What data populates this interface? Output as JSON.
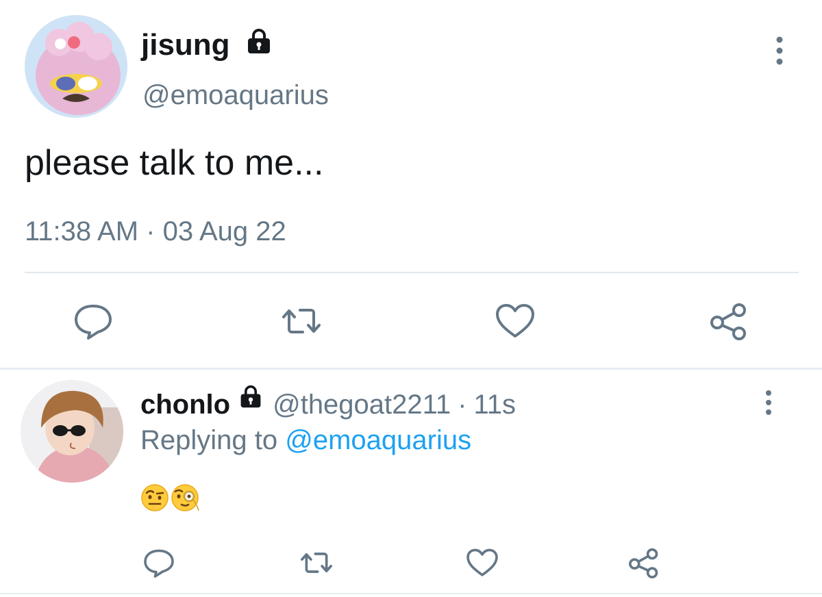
{
  "tweet": {
    "display_name": "jisung",
    "handle": "@emoaquarius",
    "text": "please talk to me...",
    "timestamp": "11:38 AM · 03 Aug 22",
    "protected_icon": "lock-icon",
    "actions": [
      "reply-icon",
      "retweet-icon",
      "like-icon",
      "share-icon"
    ]
  },
  "reply": {
    "display_name": "chonlo",
    "handle": "@thegoat2211",
    "separator": "·",
    "time": "11s",
    "replying_prefix": "Replying to",
    "replying_to": "@emoaquarius",
    "emoji": [
      "🤨",
      "🧐"
    ],
    "protected_icon": "lock-icon",
    "actions": [
      "reply-icon",
      "retweet-icon",
      "like-icon",
      "share-icon"
    ]
  },
  "colors": {
    "text": "#14171a",
    "secondary": "#657786",
    "link": "#1da1f2",
    "divider": "#e1e8ed"
  }
}
